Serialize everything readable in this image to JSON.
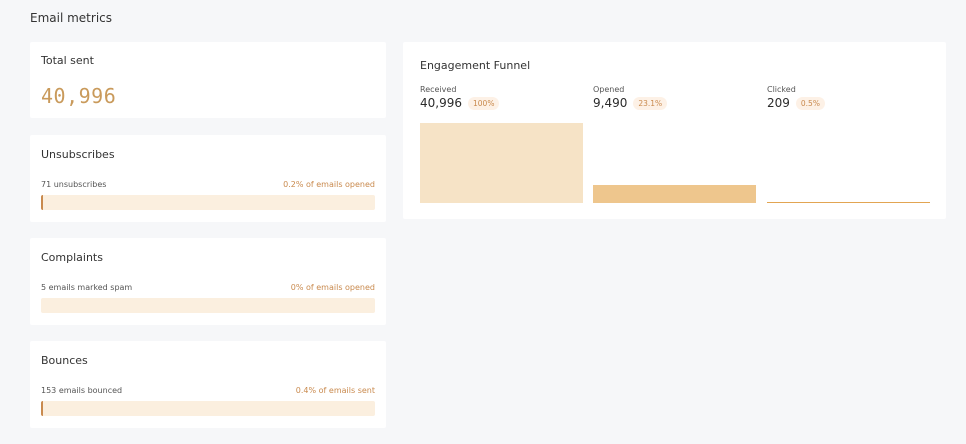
{
  "page": {
    "title": "Email metrics"
  },
  "total_sent": {
    "title": "Total sent",
    "value": "40,996"
  },
  "unsubscribes": {
    "title": "Unsubscribes",
    "detail": "71 unsubscribes",
    "ratio": "0.2% of emails opened",
    "fill_fraction": 0.002
  },
  "complaints": {
    "title": "Complaints",
    "detail": "5 emails marked spam",
    "ratio": "0% of emails opened",
    "fill_fraction": 0
  },
  "bounces": {
    "title": "Bounces",
    "detail": "153 emails bounced",
    "ratio": "0.4% of emails sent",
    "fill_fraction": 0.004
  },
  "funnel": {
    "title": "Engagement Funnel",
    "stages": [
      {
        "label": "Received",
        "value": "40,996",
        "percent": "100%",
        "fraction": 1.0,
        "color": "#f6e3c6"
      },
      {
        "label": "Opened",
        "value": "9,490",
        "percent": "23.1%",
        "fraction": 0.231,
        "color": "#eec68d"
      },
      {
        "label": "Clicked",
        "value": "209",
        "percent": "0.5%",
        "fraction": 0.005,
        "color": "#e2a552"
      }
    ]
  }
}
